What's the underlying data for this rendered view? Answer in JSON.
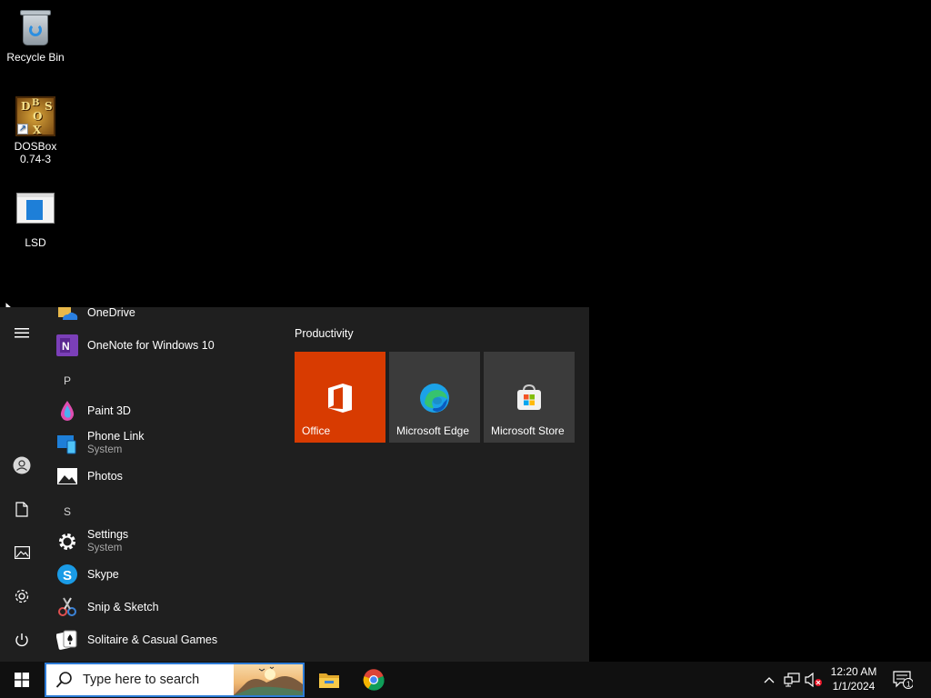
{
  "desktop": {
    "icons": [
      {
        "label": "Recycle Bin"
      },
      {
        "label_line1": "DOSBox",
        "label_line2": "0.74-3",
        "art": [
          "D",
          "O",
          "S",
          "B",
          "X"
        ]
      },
      {
        "label": "LSD"
      }
    ]
  },
  "start_menu": {
    "rail": [
      "menu-icon",
      "user-icon",
      "documents-icon",
      "pictures-icon",
      "settings-icon",
      "power-icon"
    ],
    "apps": [
      {
        "name": "OneDrive"
      },
      {
        "name": "OneNote for Windows 10"
      },
      {
        "letter": "P"
      },
      {
        "name": "Paint 3D"
      },
      {
        "name": "Phone Link",
        "sub": "System"
      },
      {
        "name": "Photos"
      },
      {
        "letter": "S"
      },
      {
        "name": "Settings",
        "sub": "System"
      },
      {
        "name": "Skype"
      },
      {
        "name": "Snip & Sketch"
      },
      {
        "name": "Solitaire & Casual Games"
      }
    ],
    "tiles_group": "Productivity",
    "tiles": [
      {
        "label": "Office",
        "color": "#d83b01",
        "glyph": "O"
      },
      {
        "label": "Microsoft Edge",
        "color": "#3b3b3b"
      },
      {
        "label": "Microsoft Store",
        "color": "#3b3b3b"
      }
    ]
  },
  "taskbar": {
    "search_placeholder": "Type here to search",
    "pinned": [
      "file-explorer-icon",
      "chrome-icon"
    ],
    "tray": [
      "chevron-up-icon",
      "network-icon",
      "volume-muted-icon"
    ],
    "time": "12:20 AM",
    "date": "1/1/2024",
    "notification_count": "1",
    "accent": "#2d7bd6"
  }
}
